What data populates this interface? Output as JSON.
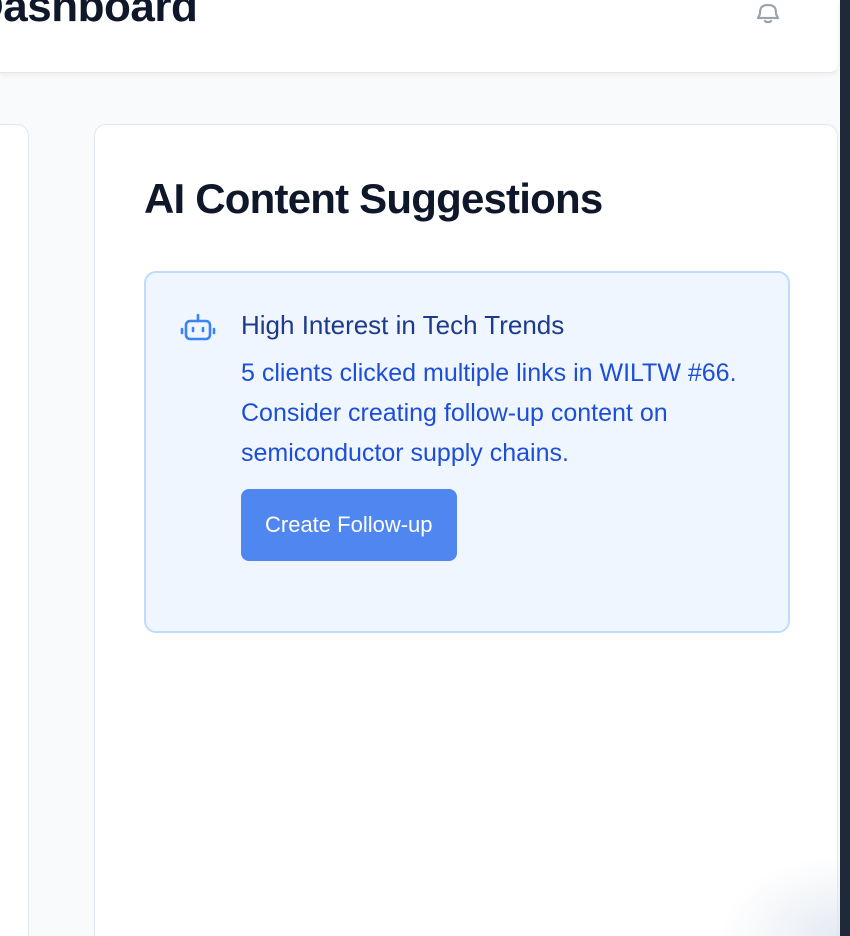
{
  "header": {
    "title": "Dashboard",
    "notifications_icon": "bell-icon"
  },
  "ai_card": {
    "title": "AI Content Suggestions",
    "suggestions": [
      {
        "icon": "robot-icon",
        "title": "High Interest in Tech Trends",
        "description": "5 clients clicked multiple links in WILTW #66. Consider creating follow-up content on semiconductor supply chains.",
        "action_label": "Create Follow-up"
      }
    ]
  },
  "colors": {
    "accent": "#4f86ef",
    "suggestion_bg": "#eff6ff",
    "suggestion_border": "#bfdbfe",
    "title_text": "#0f172a"
  }
}
